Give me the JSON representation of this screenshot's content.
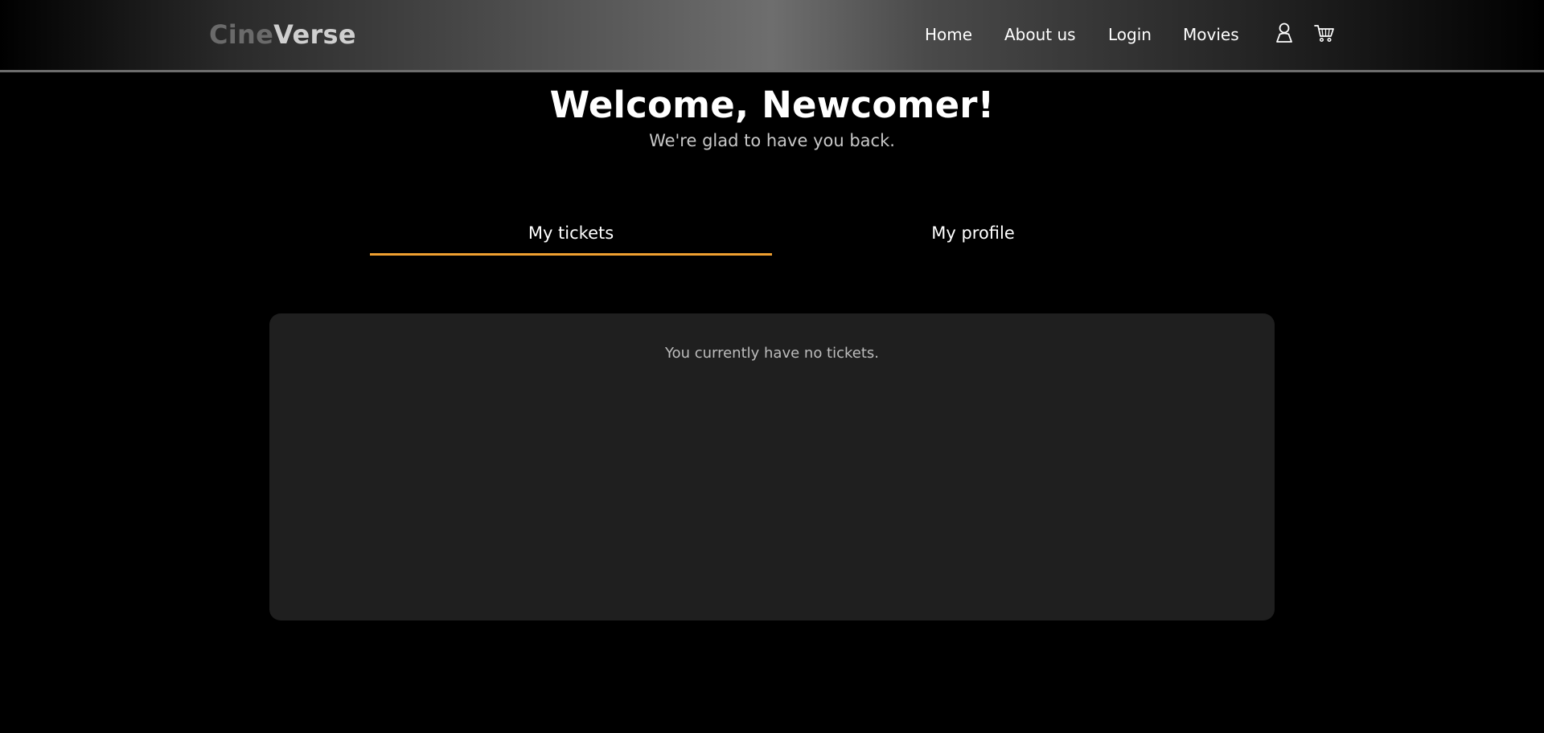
{
  "brand": {
    "part1": "Cine",
    "part2": "Verse"
  },
  "nav": {
    "items": [
      "Home",
      "About us",
      "Login",
      "Movies"
    ],
    "icons": [
      "user-icon",
      "cart-icon"
    ]
  },
  "hero": {
    "title": "Welcome, Newcomer!",
    "subtitle": "We're glad to have you back."
  },
  "tabs": [
    {
      "label": "My tickets",
      "active": true
    },
    {
      "label": "My profile",
      "active": false
    }
  ],
  "tickets": {
    "empty_message": "You currently have no tickets."
  },
  "colors": {
    "accent": "#f0a030",
    "panel": "#1f1f1f",
    "background": "#000000"
  }
}
